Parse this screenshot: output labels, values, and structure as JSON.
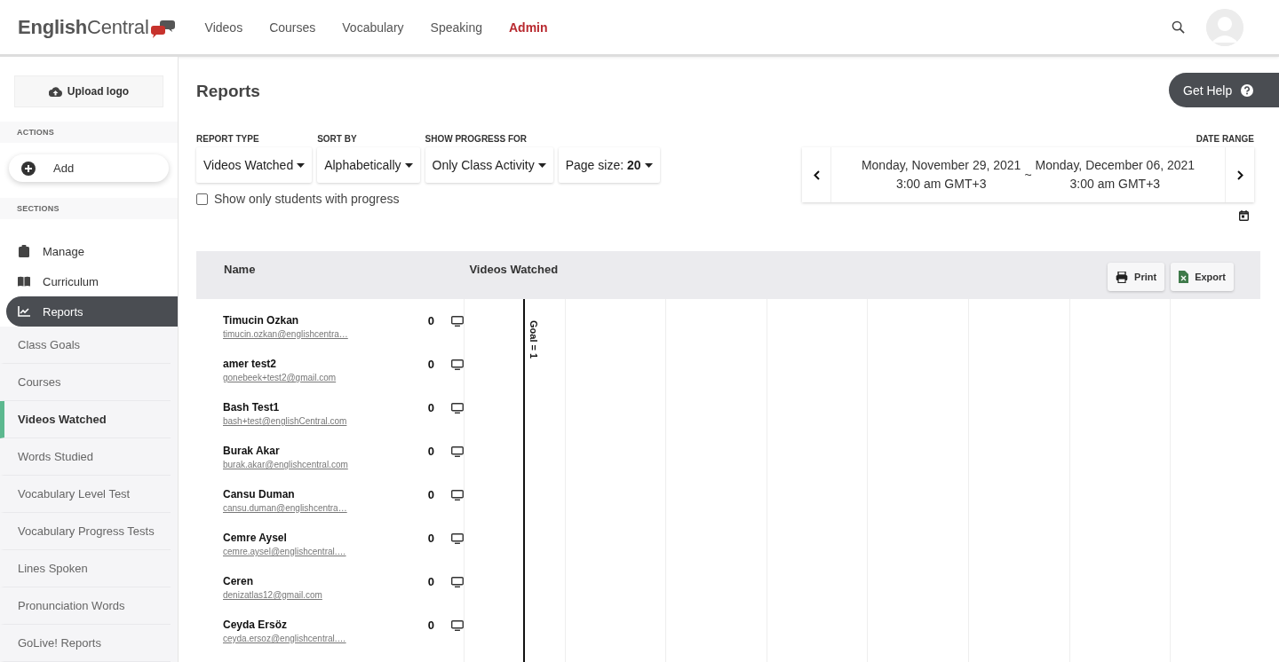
{
  "header": {
    "logo": "**English**Central",
    "nav": [
      {
        "label": "Videos",
        "selected": false
      },
      {
        "label": "Courses",
        "selected": false
      },
      {
        "label": "Vocabulary",
        "selected": false
      },
      {
        "label": "Speaking",
        "selected": false
      },
      {
        "label": "Admin",
        "selected": true
      }
    ]
  },
  "sidebar": {
    "upload_button": "Upload logo",
    "actions_heading": "ACTIONS",
    "add_button": "Add",
    "sections_heading": "SECTIONS",
    "sections": [
      {
        "label": "Manage",
        "kind": "clipboard",
        "selected": false
      },
      {
        "label": "Curriculum",
        "kind": "book",
        "selected": false
      },
      {
        "label": "Reports",
        "kind": "chart",
        "selected": true
      }
    ],
    "report_items": [
      {
        "label": "Class Goals",
        "selected": false
      },
      {
        "label": "Courses",
        "selected": false
      },
      {
        "label": "Videos Watched",
        "selected": true
      },
      {
        "label": "Words Studied",
        "selected": false
      },
      {
        "label": "Vocabulary Level Test",
        "selected": false
      },
      {
        "label": "Vocabulary Progress Tests",
        "selected": false
      },
      {
        "label": "Lines Spoken",
        "selected": false
      },
      {
        "label": "Pronunciation Words",
        "selected": false
      },
      {
        "label": "GoLive! Reports",
        "selected": false
      }
    ]
  },
  "main": {
    "title": "Reports",
    "help_button": "Get Help",
    "filters": [
      {
        "label": "REPORT TYPE",
        "value": "Videos Watched"
      },
      {
        "label": "SORT BY",
        "value": "Alphabetically"
      },
      {
        "label": "SHOW PROGRESS FOR",
        "value": "Only Class Activity"
      },
      {
        "value": "Page size: **20**"
      }
    ],
    "progress_checkbox": {
      "label": "Show only students with progress",
      "checked": false
    },
    "date_range": {
      "label": "DATE RANGE",
      "start_date": "Monday, November 29, 2021",
      "start_time": "3:00 am GMT+3",
      "separator": "~",
      "end_date": "Monday, December 06, 2021",
      "end_time": "3:00 am GMT+3"
    },
    "table": {
      "columns": [
        "Name",
        "Videos Watched"
      ],
      "print_button": "Print",
      "export_button": "Export",
      "goal_label": "Goal = 1",
      "rows": [
        {
          "name": "Timucin Ozkan",
          "email": "timucin.ozkan@englishcentra…",
          "count": "0"
        },
        {
          "name": "amer test2",
          "email": "gonebeek+test2@gmail.com",
          "count": "0"
        },
        {
          "name": "Bash Test1",
          "email": "bash+test@englishCentral.com",
          "count": "0"
        },
        {
          "name": "Burak Akar",
          "email": "burak.akar@englishcentral.com",
          "count": "0"
        },
        {
          "name": "Cansu Duman",
          "email": "cansu.duman@englishcentra…",
          "count": "0"
        },
        {
          "name": "Cemre Aysel",
          "email": "cemre.aysel@englishcentral.…",
          "count": "0"
        },
        {
          "name": "Ceren",
          "email": "denizatlas12@gmail.com",
          "count": "0"
        },
        {
          "name": "Ceyda Ersöz",
          "email": "ceyda.ersoz@englishcentral.…",
          "count": "0"
        }
      ]
    }
  }
}
